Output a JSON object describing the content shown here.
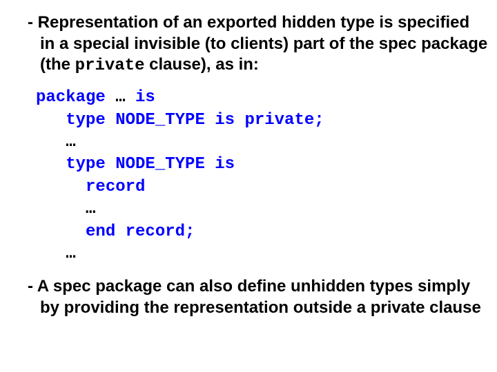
{
  "bullet1": {
    "dash": "- ",
    "t1": "Representation of an exported hidden type is specified in a special invisible (to clients) part of the spec package (the ",
    "kw": "private",
    "t2": " clause), as in:"
  },
  "code": {
    "l1a": "package ",
    "l1b": "… ",
    "l1c": "is",
    "l2": "   type NODE_TYPE is private;",
    "l3": "   …",
    "l4": "   type NODE_TYPE is",
    "l5": "     record",
    "l6": "     …",
    "l7": "     end record;",
    "l8": "   …"
  },
  "bullet2": {
    "dash": "- ",
    "text": "A spec package can also define unhidden types simply by providing the representation outside a private clause"
  }
}
